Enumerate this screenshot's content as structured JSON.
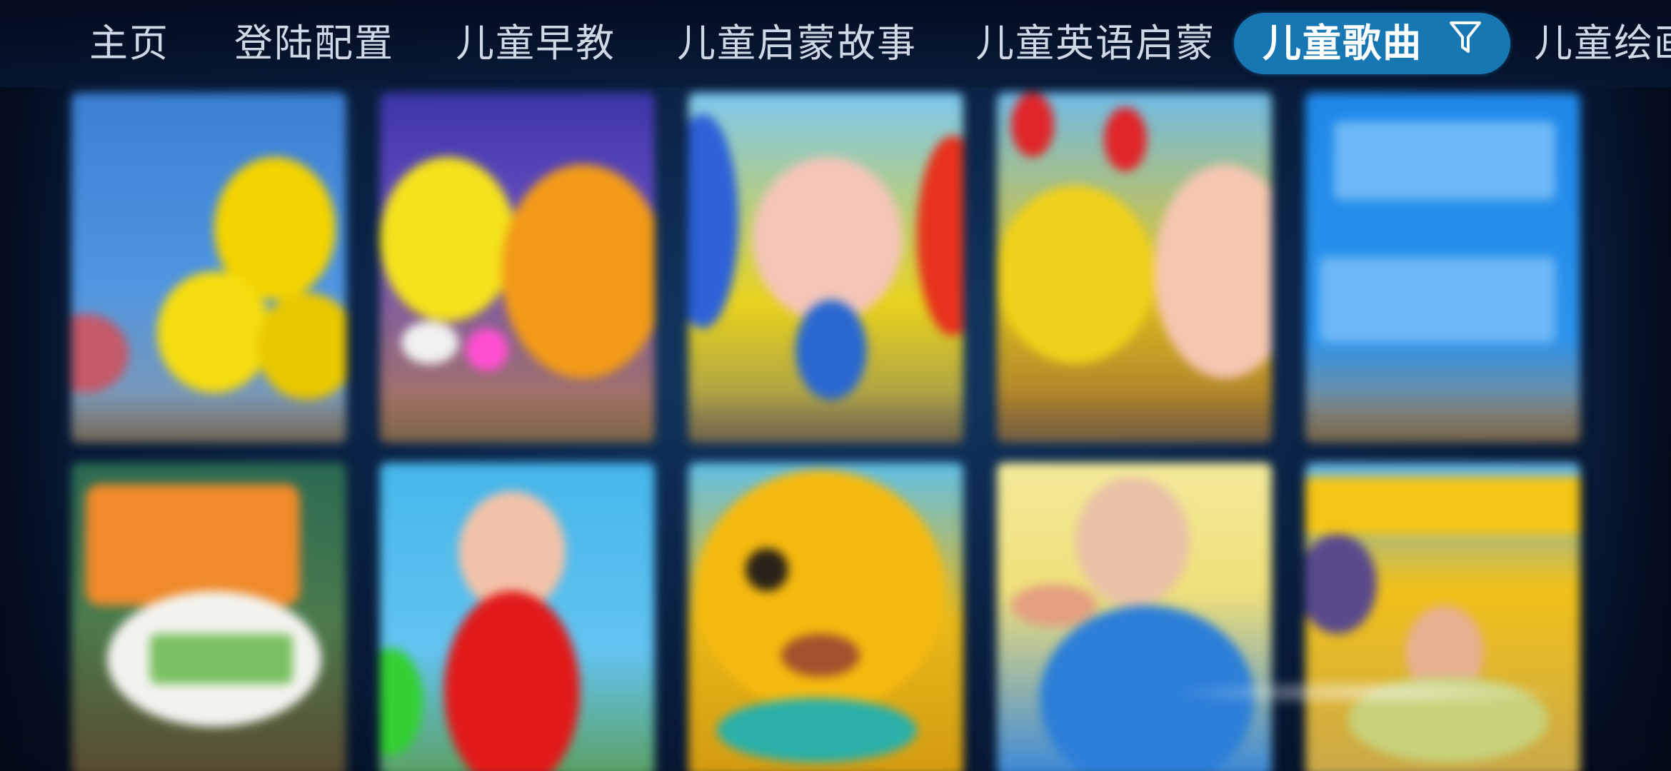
{
  "nav": {
    "tabs": [
      {
        "label": "主页"
      },
      {
        "label": "登陆配置"
      },
      {
        "label": "儿童早教"
      },
      {
        "label": "儿童启蒙故事"
      },
      {
        "label": "儿童英语启蒙"
      },
      {
        "label": "儿童歌曲",
        "active": true
      },
      {
        "label": "儿童绘画"
      }
    ],
    "active_tab_color": "#1677b3",
    "filter_icon": "filter-icon"
  },
  "grid": {
    "rows": 2,
    "columns": 5,
    "thumbnails_blurred": true
  },
  "colors": {
    "background": "#0b2448",
    "tab_text": "#cfd8e6",
    "active_tab_text": "#ffffff"
  }
}
